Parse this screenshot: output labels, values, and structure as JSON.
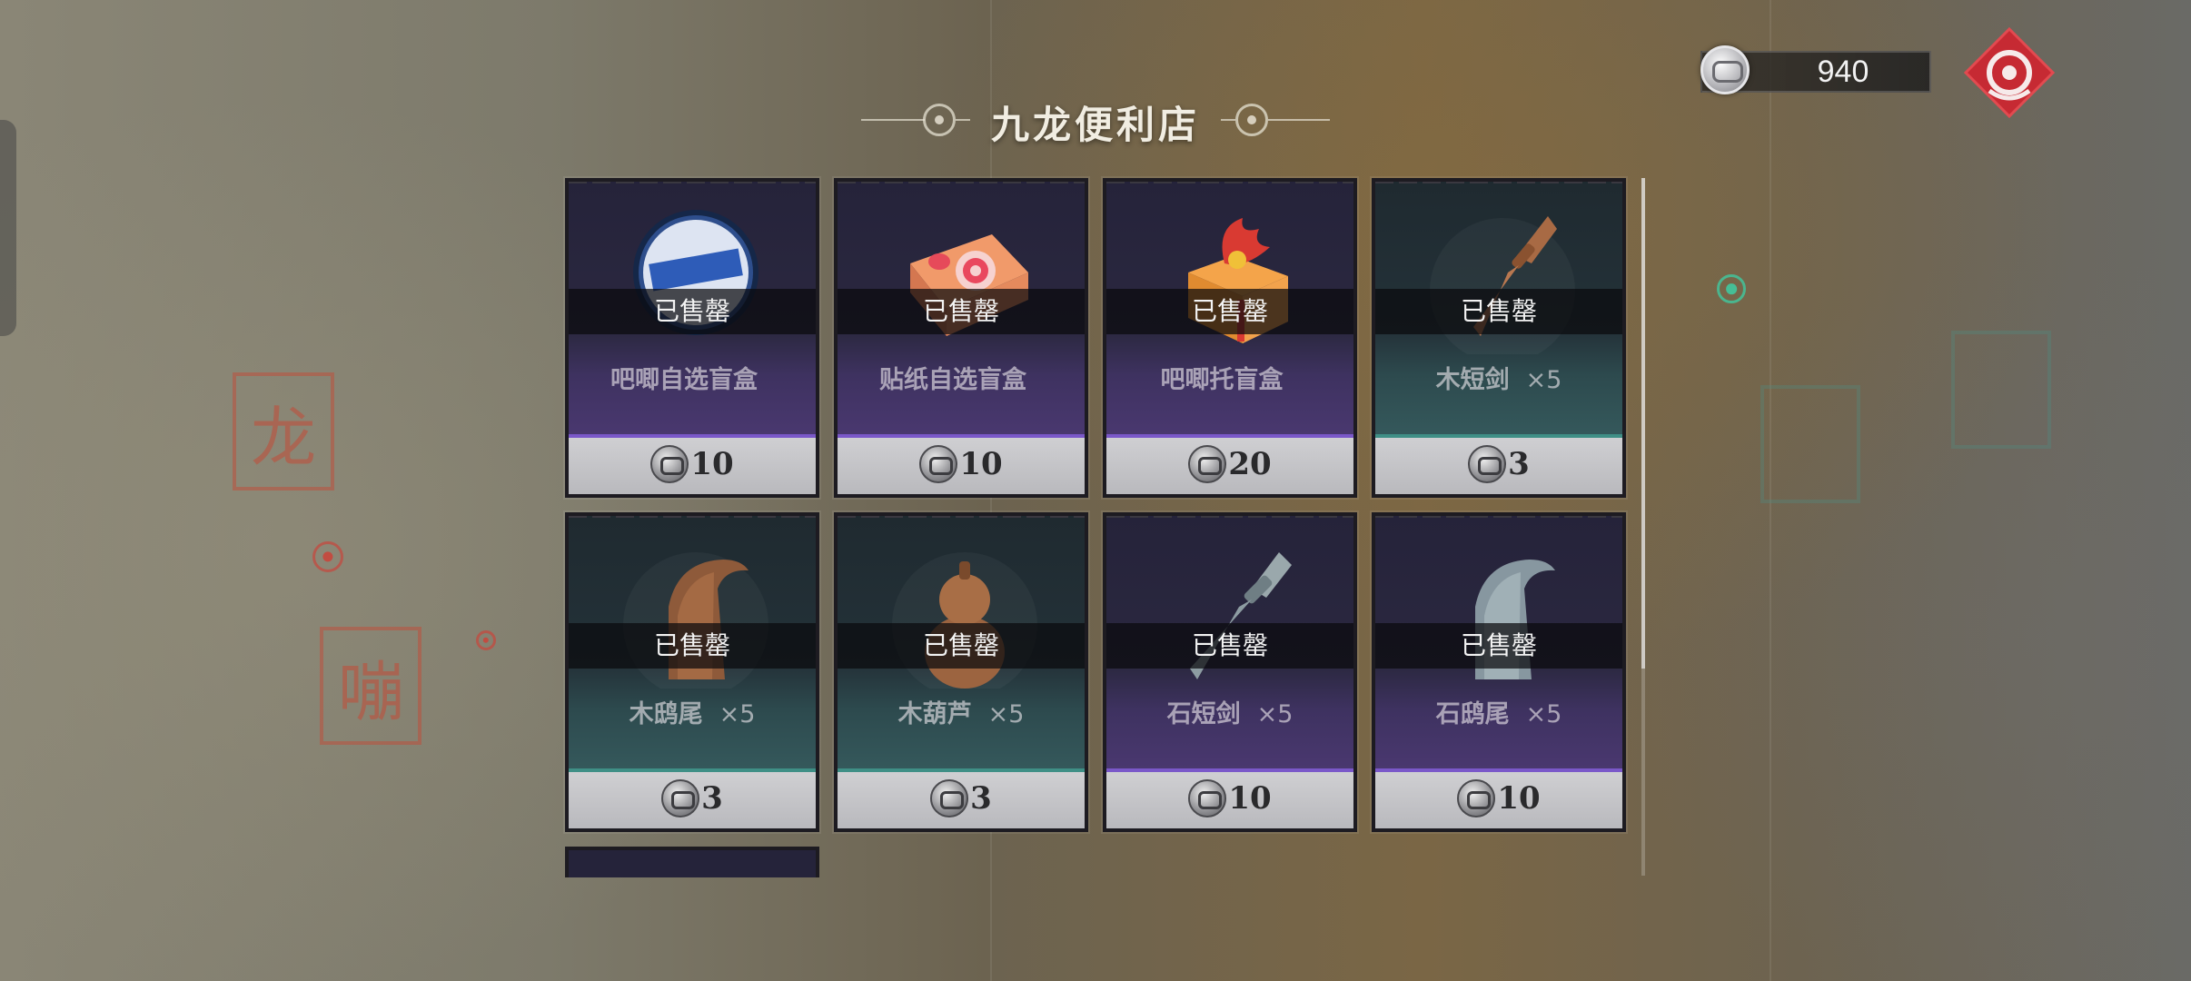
{
  "shop": {
    "title": "九龙便利店"
  },
  "currency": {
    "amount": "940",
    "icon": "silver-coin-icon"
  },
  "seals": {
    "left_top": "龙",
    "left_bottom": "嘣"
  },
  "items": [
    {
      "name": "吧唧自选盲盒",
      "qty": "",
      "status": "已售罄",
      "price": "10",
      "theme": "purple",
      "icon": "badge-tin-icon"
    },
    {
      "name": "贴纸自选盲盒",
      "qty": "",
      "status": "已售罄",
      "price": "10",
      "theme": "purple",
      "icon": "sticker-box-icon"
    },
    {
      "name": "吧唧托盲盒",
      "qty": "",
      "status": "已售罄",
      "price": "20",
      "theme": "purple",
      "icon": "rooster-box-icon"
    },
    {
      "name": "木短剑",
      "qty": "×5",
      "status": "已售罄",
      "price": "3",
      "theme": "teal",
      "icon": "wood-dagger-icon"
    },
    {
      "name": "木鸱尾",
      "qty": "×5",
      "status": "已售罄",
      "price": "3",
      "theme": "teal",
      "icon": "wood-ridge-ornament-icon"
    },
    {
      "name": "木葫芦",
      "qty": "×5",
      "status": "已售罄",
      "price": "3",
      "theme": "teal",
      "icon": "wood-gourd-icon"
    },
    {
      "name": "石短剑",
      "qty": "×5",
      "status": "已售罄",
      "price": "10",
      "theme": "purple",
      "icon": "stone-dagger-icon"
    },
    {
      "name": "石鸱尾",
      "qty": "×5",
      "status": "已售罄",
      "price": "10",
      "theme": "purple",
      "icon": "stone-ridge-ornament-icon"
    }
  ]
}
